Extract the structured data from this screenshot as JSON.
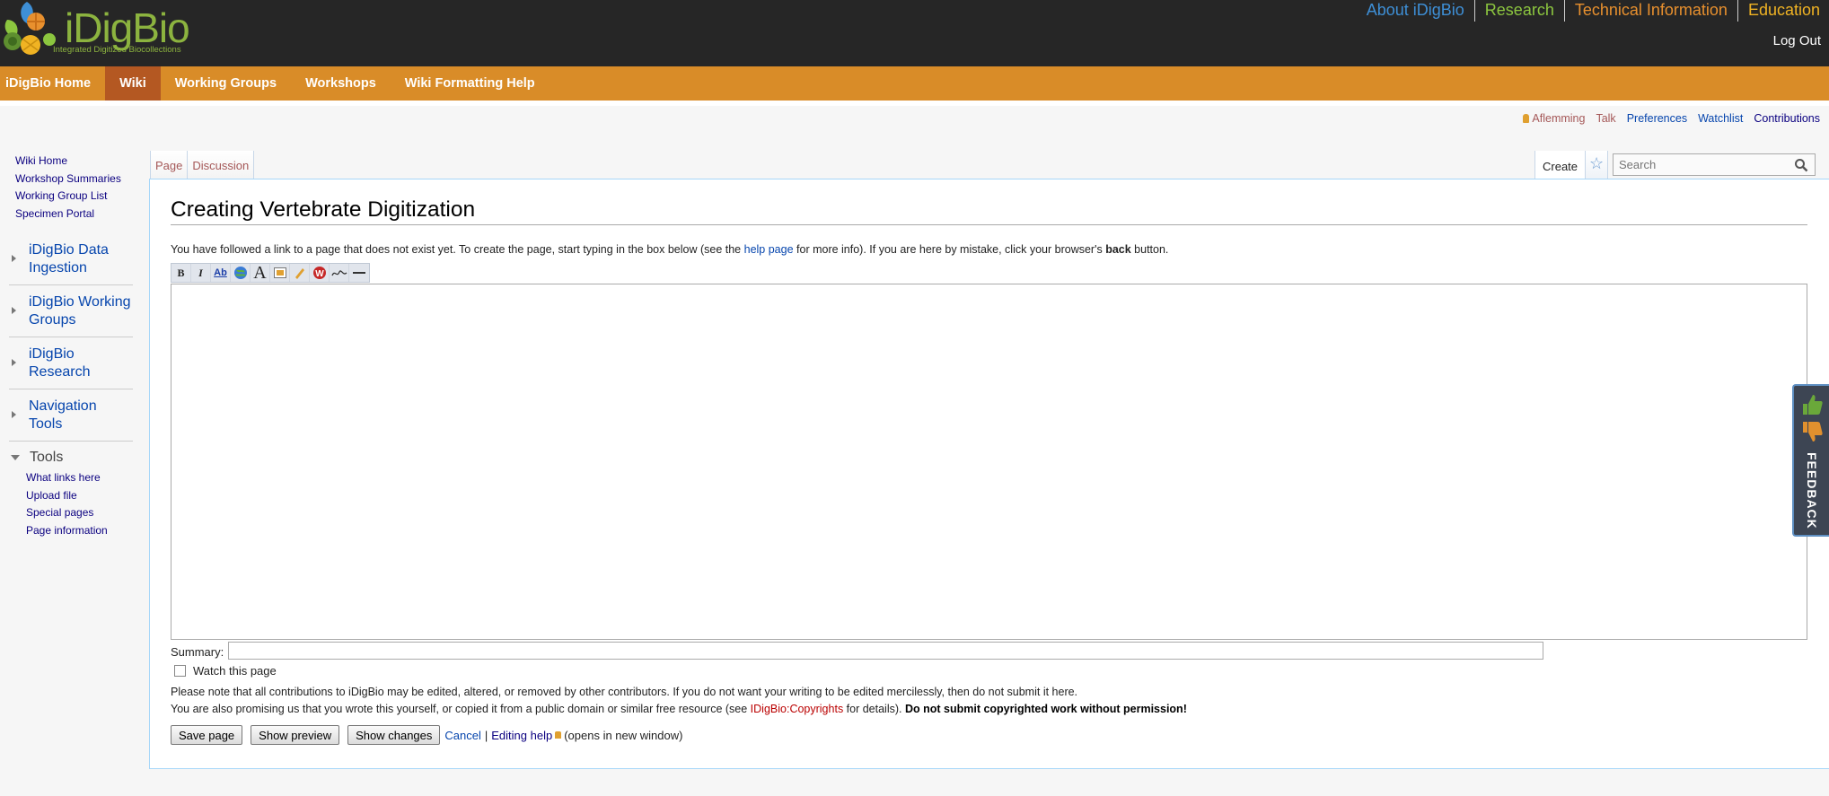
{
  "brand": {
    "name": "iDigBio",
    "tagline": "Integrated Digitized Biocollections"
  },
  "top_nav": [
    {
      "label": "About iDigBio",
      "color": "#3e8fd6"
    },
    {
      "label": "Research",
      "color": "#8cc63f"
    },
    {
      "label": "Technical Information",
      "color": "#e8902e"
    },
    {
      "label": "Education",
      "color": "#f0b323"
    }
  ],
  "logout_label": "Log Out",
  "main_nav": [
    {
      "label": "iDigBio Home",
      "active": false
    },
    {
      "label": "Wiki",
      "active": true
    },
    {
      "label": "Working Groups",
      "active": false
    },
    {
      "label": "Workshops",
      "active": false
    },
    {
      "label": "Wiki Formatting Help",
      "active": false
    }
  ],
  "personal_tools": {
    "username": "Aflemming",
    "talk": "Talk",
    "preferences": "Preferences",
    "watchlist": "Watchlist",
    "contributions": "Contributions"
  },
  "sidebar": {
    "links": [
      "Wiki Home",
      "Workshop Summaries",
      "Working Group List",
      "Specimen Portal"
    ],
    "portals": [
      "iDigBio Data Ingestion",
      "iDigBio Working Groups",
      "iDigBio Research",
      "Navigation Tools"
    ],
    "tools_title": "Tools",
    "tools_links": [
      "What links here",
      "Upload file",
      "Special pages",
      "Page information"
    ]
  },
  "tabs": {
    "page": "Page",
    "discussion": "Discussion",
    "create": "Create"
  },
  "search": {
    "placeholder": "Search"
  },
  "content": {
    "title": "Creating Vertebrate Digitization",
    "notice_pre": "You have followed a link to a page that does not exist yet. To create the page, start typing in the box below (see the ",
    "notice_link": "help page",
    "notice_mid": " for more info). If you are here by mistake, click your browser's ",
    "notice_bold": "back",
    "notice_post": " button.",
    "summary_label": "Summary:",
    "watch_label": "Watch this page",
    "warning1": "Please note that all contributions to iDigBio may be edited, altered, or removed by other contributors. If you do not want your writing to be edited mercilessly, then do not submit it here.",
    "warning2_pre": "You are also promising us that you wrote this yourself, or copied it from a public domain or similar free resource (see ",
    "warning2_link": "IDigBio:Copyrights",
    "warning2_mid": " for details). ",
    "warning2_bold": "Do not submit copyrighted work without permission!",
    "save_label": "Save page",
    "preview_label": "Show preview",
    "changes_label": "Show changes",
    "cancel_label": "Cancel",
    "separator": "|",
    "editing_help_label": "Editing help",
    "new_window_label": "(opens in new window)"
  },
  "toolbar_icons": [
    "bold-icon",
    "italic-icon",
    "internal-link-icon",
    "external-link-icon",
    "heading-icon",
    "embedded-file-icon",
    "media-link-icon",
    "nowiki-icon",
    "signature-icon",
    "horizontal-line-icon"
  ],
  "feedback_label": "FEEDBACK",
  "colors": {
    "header_bg": "#262626",
    "nav_orange": "#d98c28",
    "nav_active": "#b45822",
    "link_blue": "#0645ad",
    "redlink": "#ba0000"
  }
}
